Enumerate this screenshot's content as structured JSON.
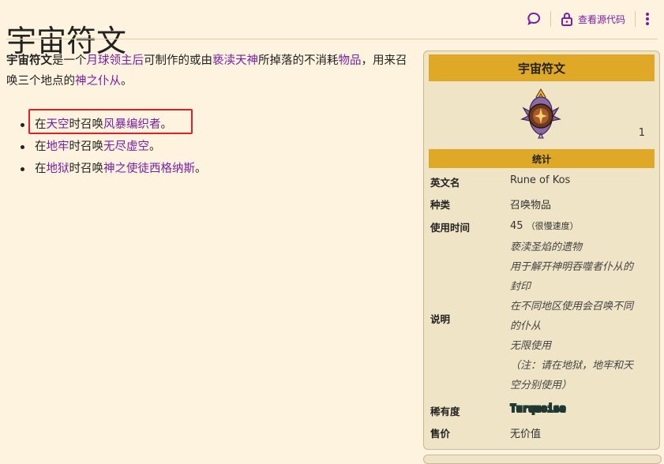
{
  "title": "宇宙符文",
  "actions": {
    "view_source": "查看源代码"
  },
  "intro": {
    "t0": "宇宙符文",
    "t1": "是一个",
    "l1": "月球领主后",
    "t2": "可制作的或由",
    "l2": "亵渎天神",
    "t3": "所掉落的不消耗",
    "l3": "物品",
    "t4": "，用来召唤三个地点的",
    "l4": "神之仆从",
    "t5": "。"
  },
  "places": [
    {
      "pre": "在",
      "loc": "天空",
      "mid": "时召唤",
      "boss": "风暴编织者",
      "post": "。"
    },
    {
      "pre": "在",
      "loc": "地牢",
      "mid": "时召唤",
      "boss": "无尽虚空",
      "post": "。"
    },
    {
      "pre": "在",
      "loc": "地狱",
      "mid": "时召唤",
      "boss": "神之使徒西格纳斯",
      "post": "。"
    }
  ],
  "infobox": {
    "title": "宇宙符文",
    "count": "1",
    "stats_header": "统计",
    "rows": {
      "english_name": {
        "k": "英文名",
        "v": "Rune of Kos"
      },
      "type": {
        "k": "种类",
        "v": "召唤物品"
      },
      "use_time": {
        "k": "使用时间",
        "v": "45",
        "note": "（很慢速度）"
      },
      "description": {
        "k": "说明"
      },
      "rarity": {
        "k": "稀有度",
        "v": "Turquoise"
      },
      "price": {
        "k": "售价",
        "v": "无价值"
      }
    },
    "desc_lines": [
      "亵渎圣焰的遗物",
      "用于解开神明吞噬者仆从的",
      "封印",
      "在不同地区使用会召唤不同",
      "的仆从",
      "无限使用",
      "（注：请在地狱，地牢和天",
      "空分别使用）"
    ]
  }
}
